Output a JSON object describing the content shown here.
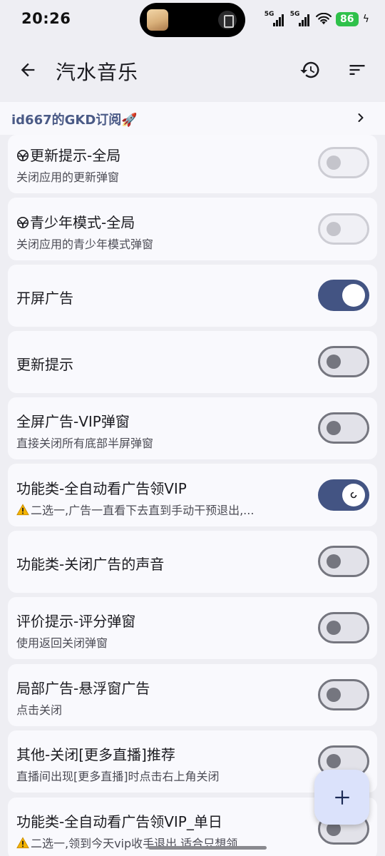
{
  "status_bar": {
    "time": "20:26",
    "signal_1": "5G",
    "signal_2": "5G",
    "battery": "86",
    "battery_color": "#2fc14a"
  },
  "toolbar": {
    "title": "汽水音乐",
    "back_icon": "arrow-back-icon",
    "history_icon": "history-icon",
    "sort_icon": "sort-icon"
  },
  "subscription": {
    "title": "id667的GKD订阅🚀"
  },
  "rules": [
    {
      "title": "更新提示-全局",
      "desc": "关闭应用的更新弹窗",
      "state": "disabled",
      "icon": "bug-icon"
    },
    {
      "title": "青少年模式-全局",
      "desc": "关闭应用的青少年模式弹窗",
      "state": "disabled",
      "icon": "bug-icon"
    },
    {
      "title": "开屏广告",
      "desc": "",
      "state": "on"
    },
    {
      "title": "更新提示",
      "desc": "",
      "state": "off"
    },
    {
      "title": "全屏广告-VIP弹窗",
      "desc": "直接关闭所有底部半屏弹窗",
      "state": "off"
    },
    {
      "title": "功能类-全自动看广告领VIP",
      "desc": "二选一,广告一直看下去直到手动干预退出,...",
      "state": "on",
      "warn": true
    },
    {
      "title": "功能类-关闭广告的声音",
      "desc": "",
      "state": "off"
    },
    {
      "title": "评价提示-评分弹窗",
      "desc": "使用返回关闭弹窗",
      "state": "off"
    },
    {
      "title": "局部广告-悬浮窗广告",
      "desc": "点击关闭",
      "state": "off"
    },
    {
      "title": "其他-关闭[更多直播]推荐",
      "desc": "直播间出现[更多直播]时点击右上角关闭",
      "state": "off"
    },
    {
      "title": "功能类-全自动看广告领VIP_单日",
      "desc": "二选一,领到今天vip收手退出,适合只想领...",
      "state": "off",
      "warn": true
    }
  ],
  "fab": {
    "icon": "plus-icon"
  },
  "colors": {
    "accent": "#435483",
    "background": "#eeeef3",
    "card": "#f9f9fd"
  }
}
